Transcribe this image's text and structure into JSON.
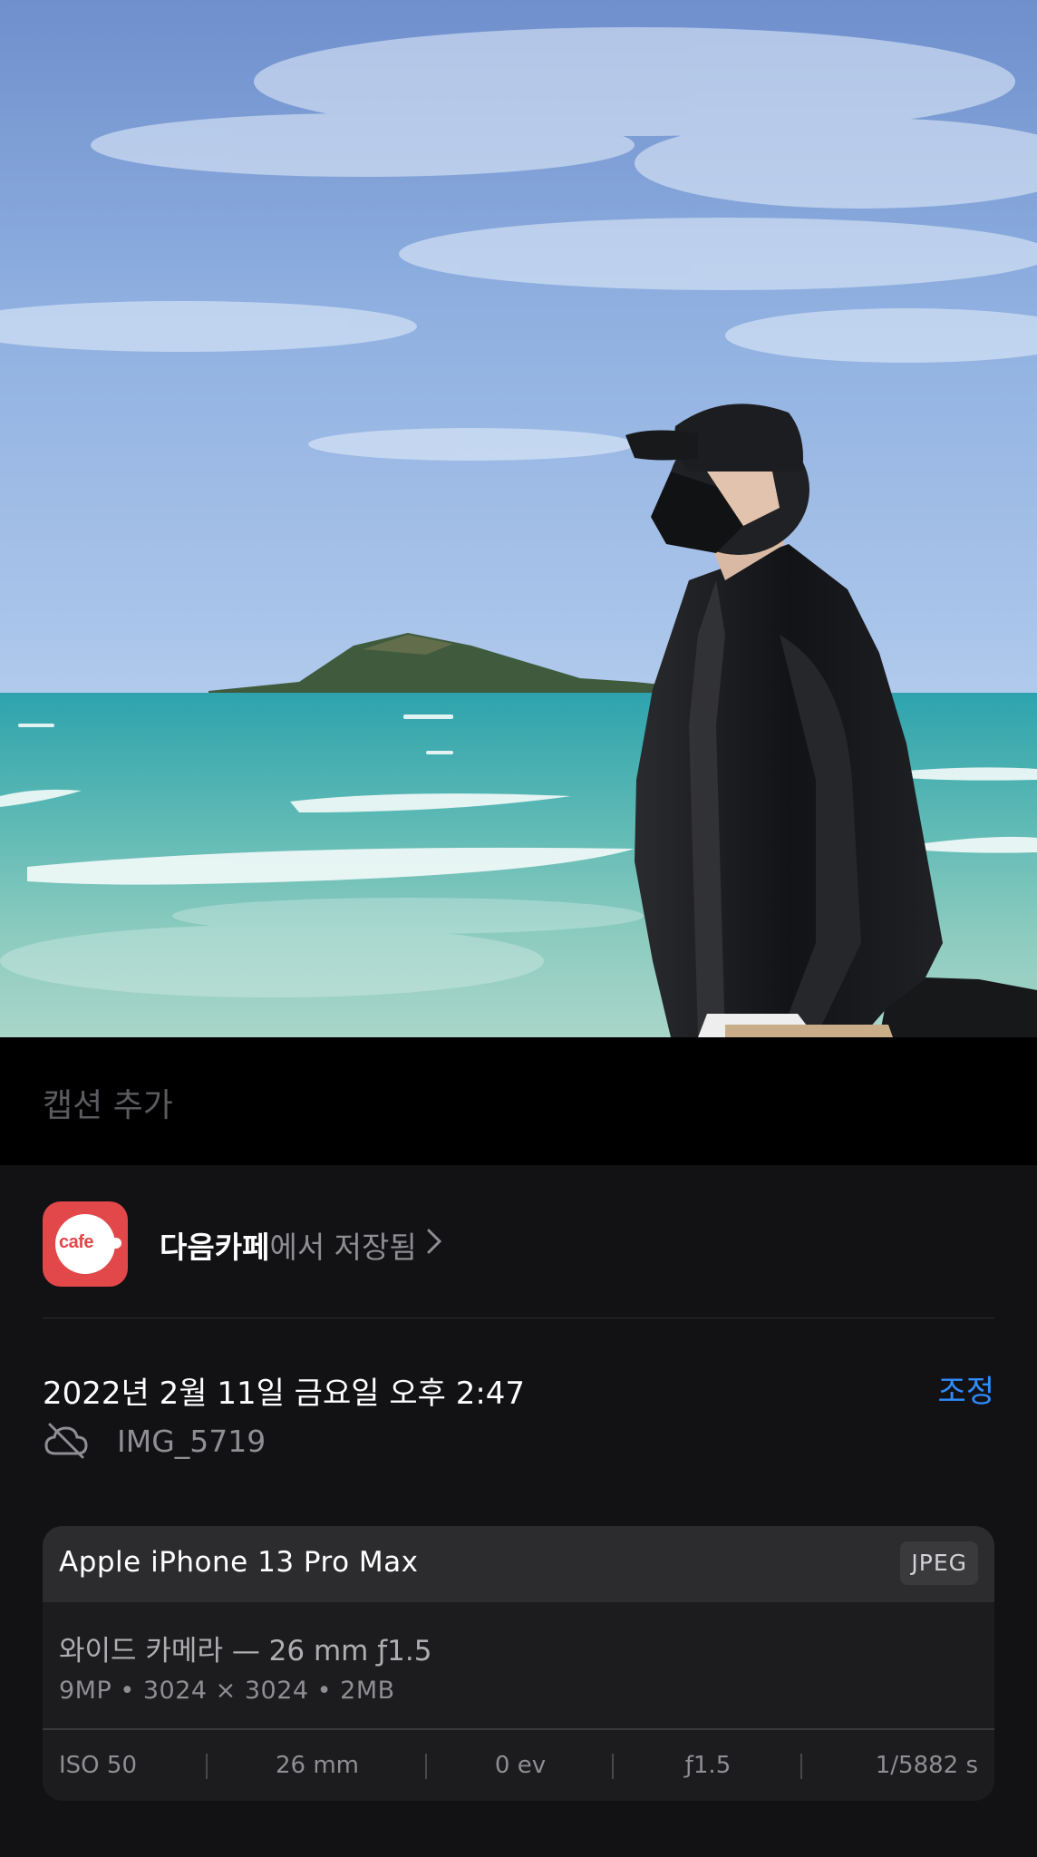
{
  "photo": {
    "description_alt": ""
  },
  "caption": {
    "placeholder": "캡션 추가"
  },
  "source": {
    "app_icon_text": "cafe",
    "app_name": "다음카페",
    "suffix": "에서 저장됨"
  },
  "datetime": "2022년 2월 11일 금요일 오후 2:47",
  "adjust_label": "조정",
  "filename": "IMG_5719",
  "exif": {
    "device": "Apple iPhone 13 Pro Max",
    "format": "JPEG",
    "lens": "와이드 카메라 — 26 mm ƒ1.5",
    "specs": "9MP  •  3024 × 3024  •  2MB",
    "iso": "ISO 50",
    "focal_length": "26 mm",
    "exposure": "0 ev",
    "aperture": "ƒ1.5",
    "shutter": "1/5882 s"
  },
  "colors": {
    "accent": "#2f8cff",
    "panel_bg": "#121214",
    "card_bg": "#1c1c1e",
    "app_icon": "#e2474a"
  },
  "icons": {
    "chevron": "chevron-right-icon",
    "cloud": "cloud-slash-icon"
  }
}
